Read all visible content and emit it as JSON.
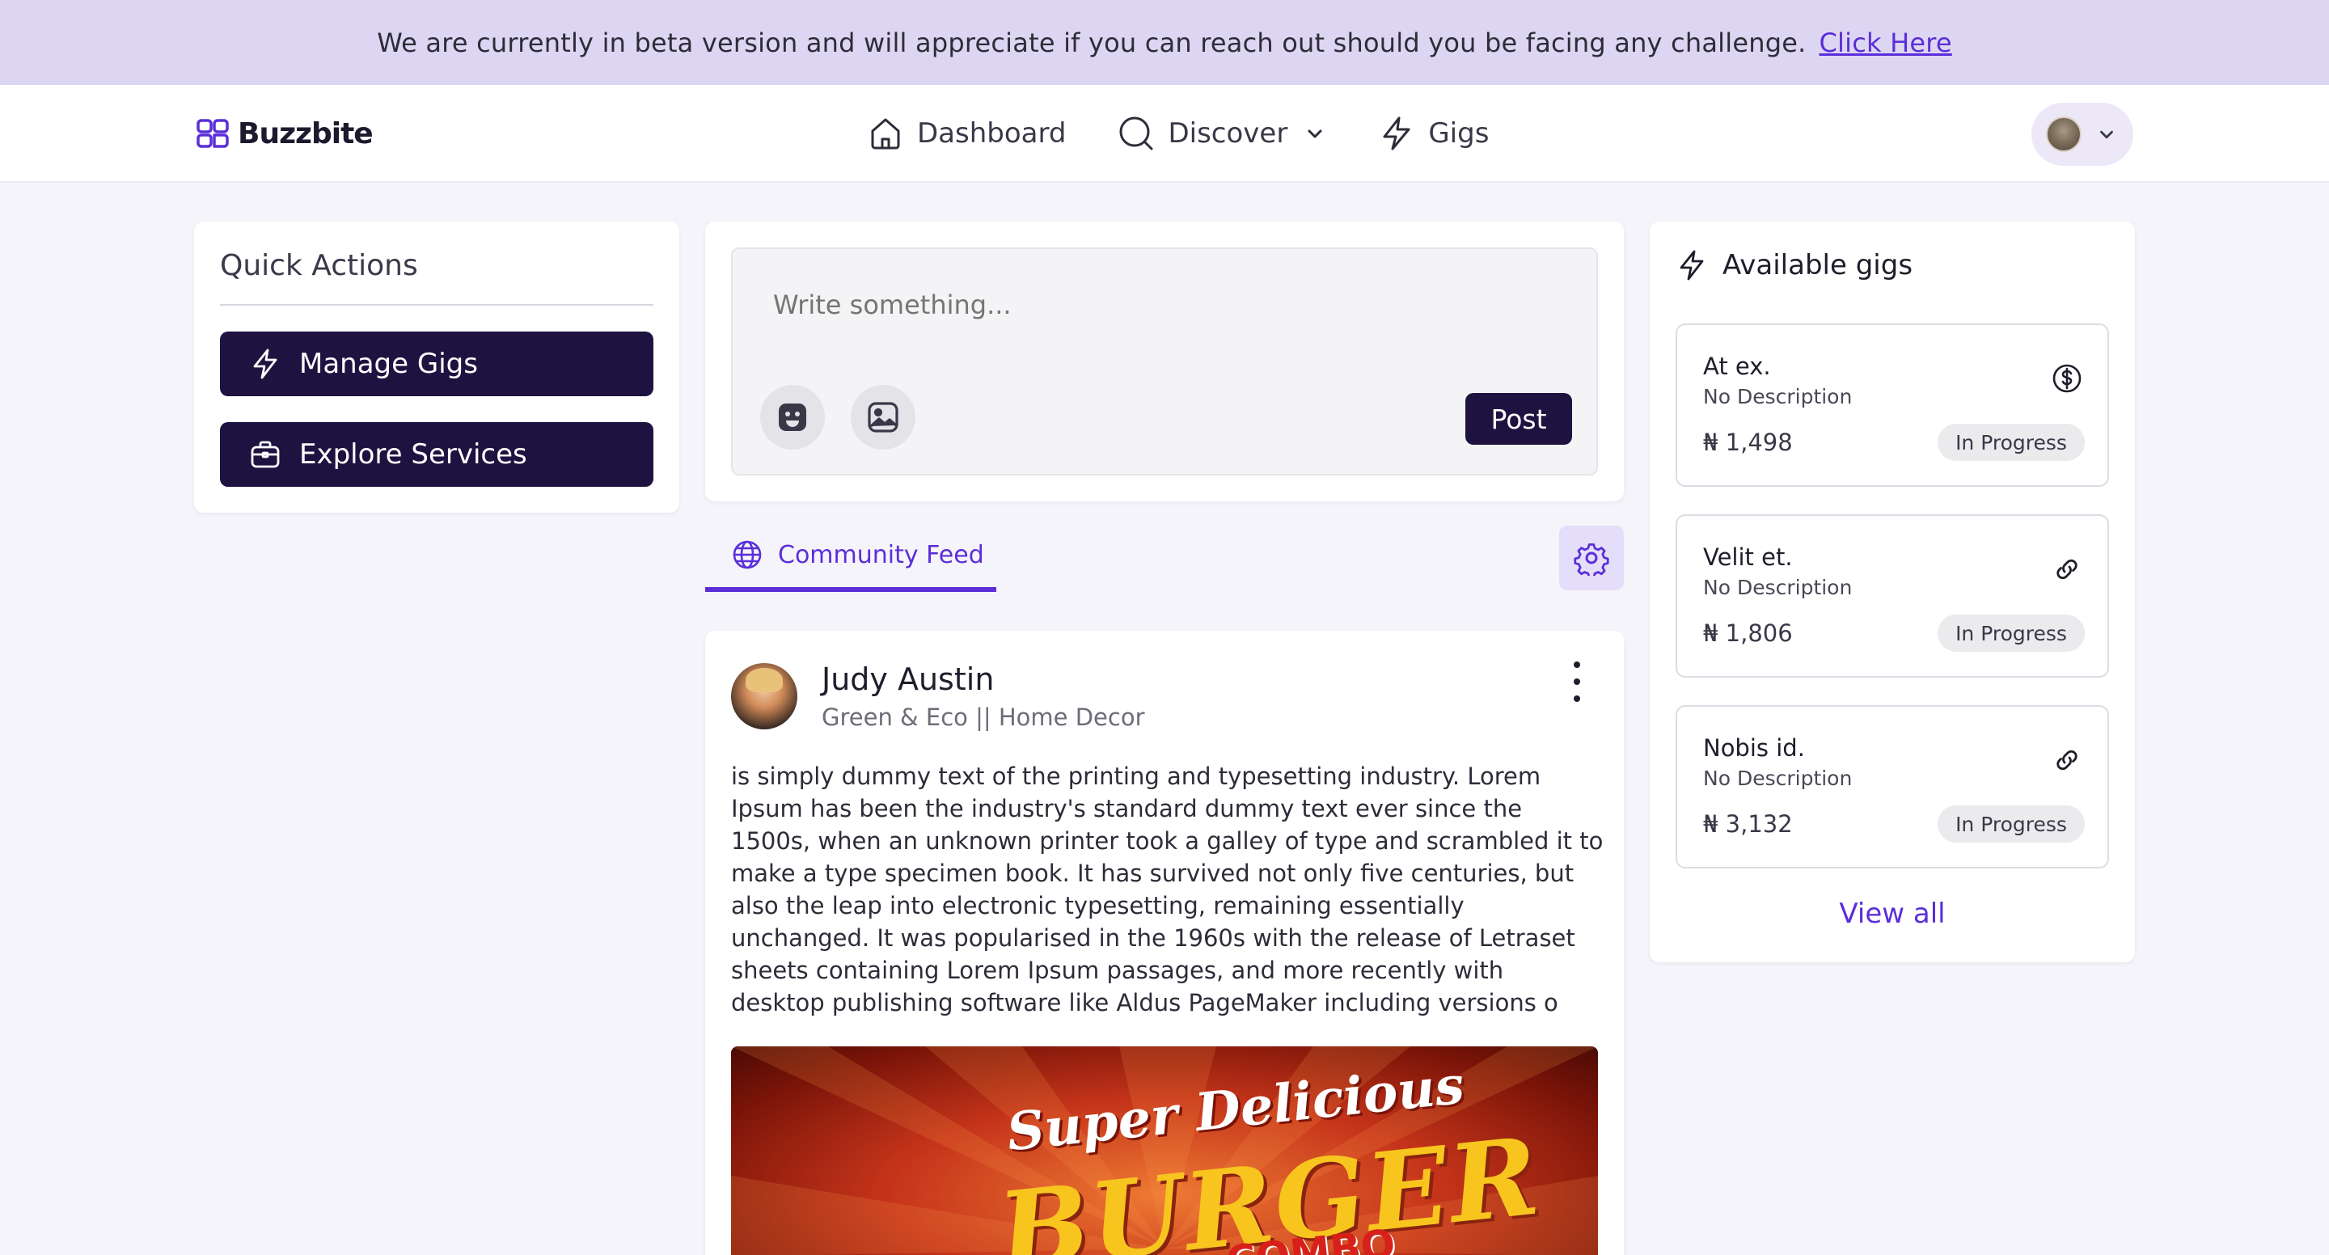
{
  "banner": {
    "message": "We are currently in beta version and will appreciate if you can reach out should you be facing any challenge.",
    "link_label": "Click Here"
  },
  "header": {
    "brand": "Buzzbite",
    "nav": [
      {
        "label": "Dashboard",
        "icon": "home-icon"
      },
      {
        "label": "Discover",
        "icon": "search-icon"
      },
      {
        "label": "Gigs",
        "icon": "lightning-icon"
      }
    ]
  },
  "quick_actions": {
    "title": "Quick Actions",
    "buttons": [
      {
        "label": "Manage Gigs",
        "icon": "lightning-icon"
      },
      {
        "label": "Explore Services",
        "icon": "briefcase-icon"
      }
    ]
  },
  "composer": {
    "placeholder": "Write something...",
    "post_label": "Post"
  },
  "feed": {
    "tab_label": "Community Feed"
  },
  "post": {
    "author": "Judy Austin",
    "subtitle": "Green & Eco || Home Decor",
    "body": "is simply dummy text of the printing and typesetting industry. Lorem Ipsum has been the industry's standard dummy text ever since the 1500s, when an unknown printer took a galley of type and scrambled it to make a type specimen book. It has survived not only five centuries, but also the leap into electronic typesetting, remaining essentially unchanged. It was popularised in the 1960s with the release of Letraset sheets containing Lorem Ipsum passages, and more recently with desktop publishing software like Aldus PageMaker including versions o",
    "image_text": [
      "Super Delicious",
      "BURGER",
      "COMBO"
    ]
  },
  "gigs": {
    "title": "Available gigs",
    "items": [
      {
        "title": "At ex.",
        "description": "No Description",
        "price": "₦ 1,498",
        "status": "In Progress",
        "icon": "dollar-circle-icon"
      },
      {
        "title": "Velit et.",
        "description": "No Description",
        "price": "₦ 1,806",
        "status": "In Progress",
        "icon": "link-icon"
      },
      {
        "title": "Nobis id.",
        "description": "No Description",
        "price": "₦ 3,132",
        "status": "In Progress",
        "icon": "link-icon"
      }
    ],
    "view_all": "View all"
  },
  "colors": {
    "accent": "#5b2ed9",
    "button_dark": "#1e1340",
    "banner_bg": "#ddd6f2",
    "page_bg": "#f5f4fa"
  }
}
